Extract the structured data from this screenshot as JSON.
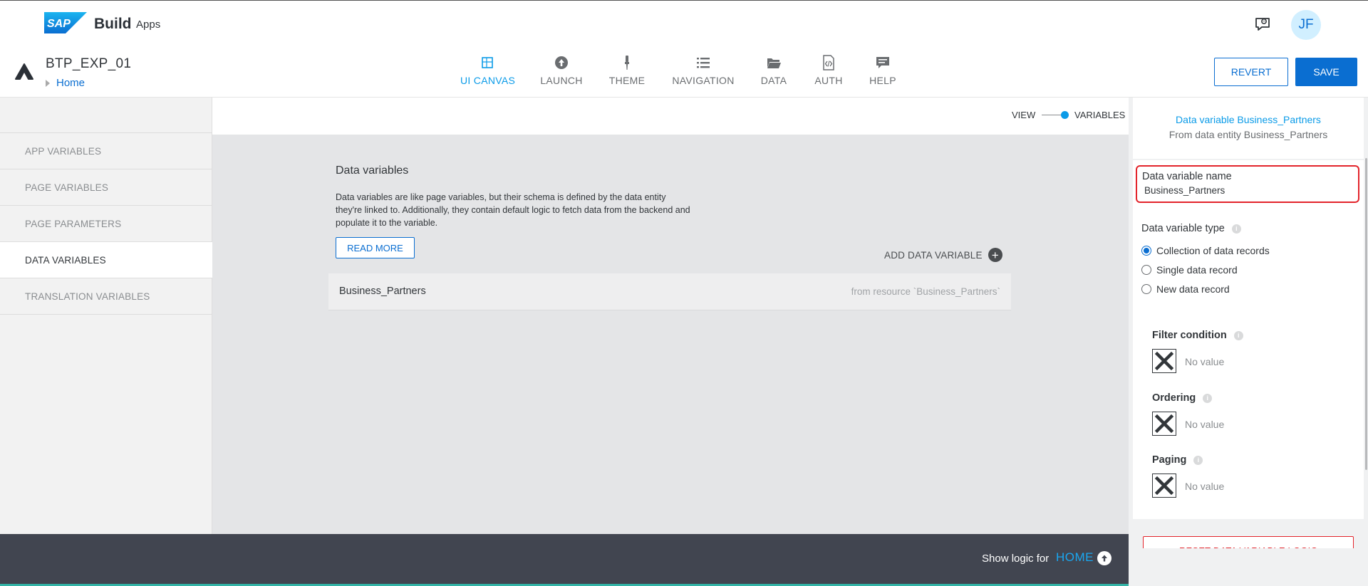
{
  "header": {
    "brand_logo_text": "SAP",
    "brand_build": "Build",
    "brand_apps": "Apps",
    "avatar_initials": "JF"
  },
  "project": {
    "name": "BTP_EXP_01",
    "breadcrumb": "Home"
  },
  "nav": {
    "items": [
      {
        "label": "UI CANVAS",
        "icon": "canvas-icon",
        "active": true
      },
      {
        "label": "LAUNCH",
        "icon": "upload-icon"
      },
      {
        "label": "THEME",
        "icon": "brush-icon"
      },
      {
        "label": "NAVIGATION",
        "icon": "list-icon"
      },
      {
        "label": "DATA",
        "icon": "folder-icon"
      },
      {
        "label": "AUTH",
        "icon": "code-file-icon"
      },
      {
        "label": "HELP",
        "icon": "chat-icon"
      }
    ]
  },
  "actions": {
    "revert": "REVERT",
    "save": "SAVE"
  },
  "sidebar": {
    "items": [
      {
        "label": "APP VARIABLES"
      },
      {
        "label": "PAGE VARIABLES"
      },
      {
        "label": "PAGE PARAMETERS"
      },
      {
        "label": "DATA VARIABLES",
        "active": true
      },
      {
        "label": "TRANSLATION VARIABLES"
      }
    ]
  },
  "toggle": {
    "view": "VIEW",
    "variables": "VARIABLES"
  },
  "main": {
    "title": "Data variables",
    "description": "Data variables are like page variables, but their schema is defined by the data entity they're linked to. Additionally, they contain default logic to fetch data from the backend and populate it to the variable.",
    "read_more": "READ MORE",
    "add_variable": "ADD DATA VARIABLE",
    "variables": [
      {
        "name": "Business_Partners",
        "source": "from resource `Business_Partners`"
      }
    ]
  },
  "logic_bar": {
    "prefix": "Show logic for",
    "target": "HOME"
  },
  "panel": {
    "header_title": "Data variable Business_Partners",
    "header_subtitle": "From data entity Business_Partners",
    "name_label": "Data variable name",
    "name_value": "Business_Partners",
    "type_label": "Data variable type",
    "type_options": [
      {
        "label": "Collection of data records",
        "selected": true
      },
      {
        "label": "Single data record"
      },
      {
        "label": "New data record"
      }
    ],
    "filter_label": "Filter condition",
    "ordering_label": "Ordering",
    "paging_label": "Paging",
    "no_value": "No value",
    "reset_button": "RESET DATA VARIABLE LOGIC"
  },
  "colors": {
    "accent": "#0a6ed1",
    "active_nav": "#0a9be8",
    "highlight_border": "#e3242b",
    "logic_bar_bg": "#414550"
  }
}
